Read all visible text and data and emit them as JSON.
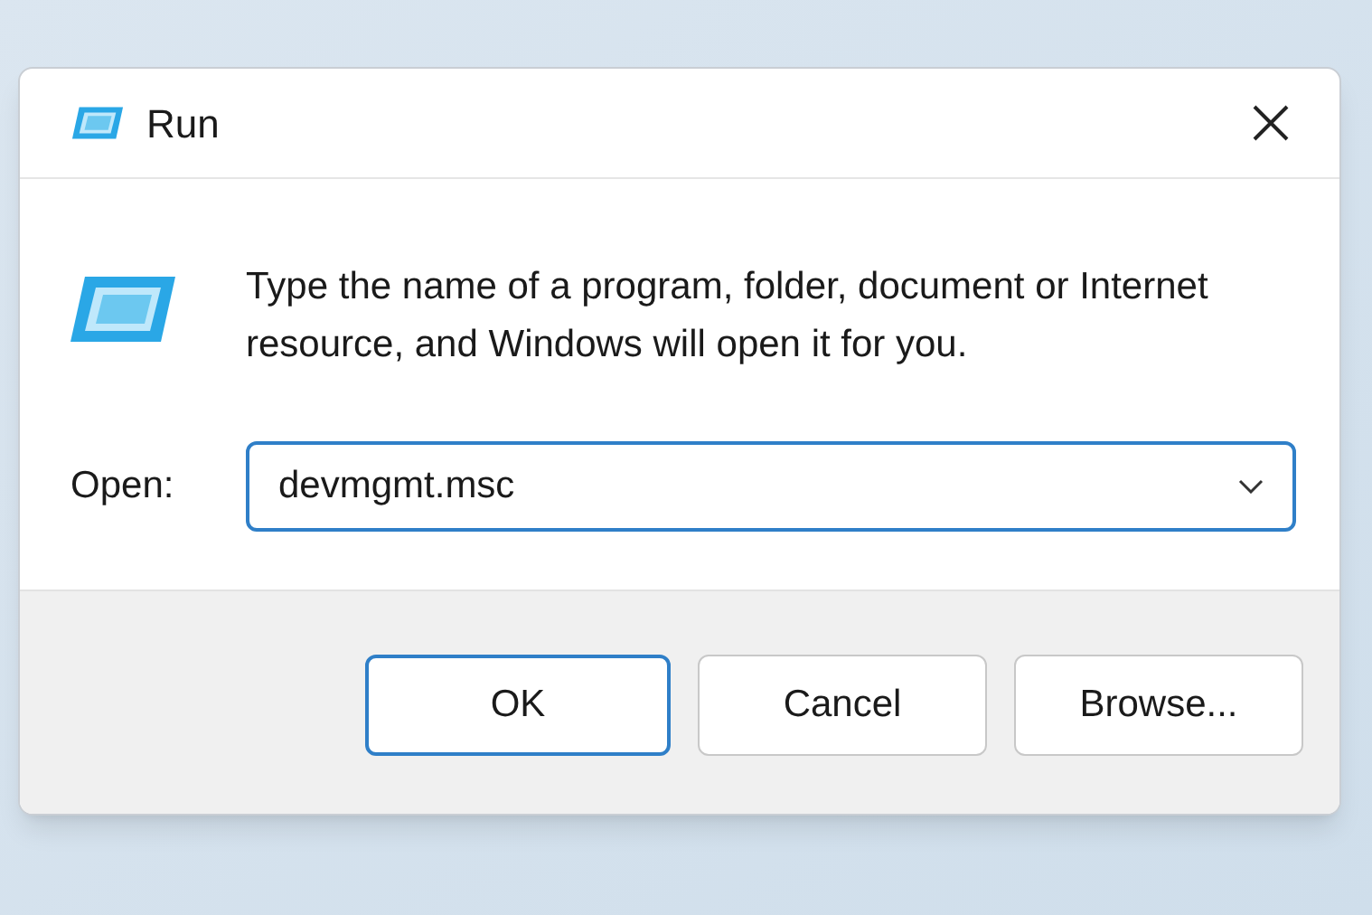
{
  "window": {
    "title": "Run"
  },
  "message": "Type the name of a program, folder, document or Internet resource, and Windows will open it for you.",
  "open_field": {
    "label": "Open:",
    "value": "devmgmt.msc"
  },
  "buttons": [
    {
      "label": "OK",
      "default": true
    },
    {
      "label": "Cancel",
      "default": false
    },
    {
      "label": "Browse...",
      "default": false
    }
  ]
}
